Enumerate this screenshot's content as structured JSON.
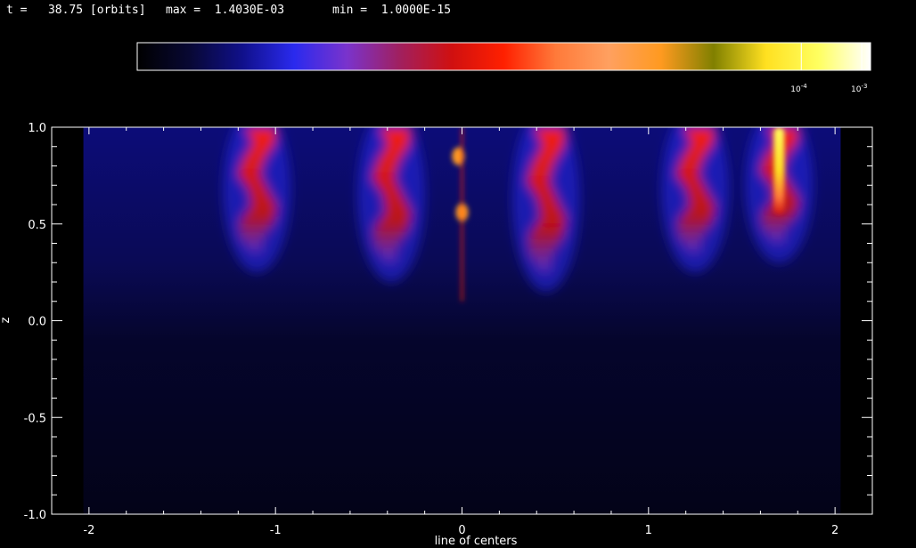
{
  "header": {
    "time_label": "t =   38.75 [orbits]",
    "max_label": "max =  1.4030E-03",
    "min_label": "min =  1.0000E-15"
  },
  "colorbar": {
    "ticks": [
      {
        "value": 0.0001,
        "label_base": "10",
        "label_exp": "-4"
      },
      {
        "value": 0.001,
        "label_base": "10",
        "label_exp": "-3"
      }
    ],
    "colors": [
      "#000000",
      "#080833",
      "#10108a",
      "#2a2aee",
      "#7a33cc",
      "#a02060",
      "#d01010",
      "#ff2000",
      "#ff7a3a",
      "#ffa060",
      "#ff9a20",
      "#808000",
      "#ffe020",
      "#ffff60",
      "#ffffff"
    ]
  },
  "chart_data": {
    "type": "heatmap",
    "xlabel": "line of centers",
    "ylabel": "z",
    "xlim": [
      -2.2,
      2.2
    ],
    "ylim": [
      -1.0,
      1.0
    ],
    "x_ticks": [
      -2,
      -1,
      0,
      1,
      2
    ],
    "x_tick_labels": [
      "-2",
      "-1",
      "0",
      "1",
      "2"
    ],
    "y_ticks": [
      -1.0,
      -0.5,
      0.0,
      0.5,
      1.0
    ],
    "y_tick_labels": [
      "-1.0",
      "-0.5",
      "0.0",
      "0.5",
      "1.0"
    ],
    "data_extent_x": [
      -2.03,
      2.03
    ],
    "features": [
      {
        "name": "plume-a",
        "x": -1.1,
        "z_top": 1.0,
        "z_bottom": 0.35,
        "level": 0.55
      },
      {
        "name": "plume-b",
        "x": -0.38,
        "z_top": 1.0,
        "z_bottom": 0.3,
        "level": 0.55
      },
      {
        "name": "plume-c",
        "x": 0.45,
        "z_top": 1.0,
        "z_bottom": 0.25,
        "level": 0.55
      },
      {
        "name": "plume-d",
        "x": 1.25,
        "z_top": 1.0,
        "z_bottom": 0.35,
        "level": 0.65
      },
      {
        "name": "plume-e",
        "x": 1.7,
        "z_top": 1.0,
        "z_bottom": 0.4,
        "level": 0.9
      },
      {
        "name": "blob-center-top",
        "x": -0.02,
        "z": 0.85,
        "level": 0.75
      },
      {
        "name": "blob-center-mid",
        "x": 0.0,
        "z": 0.56,
        "level": 0.75
      }
    ]
  }
}
